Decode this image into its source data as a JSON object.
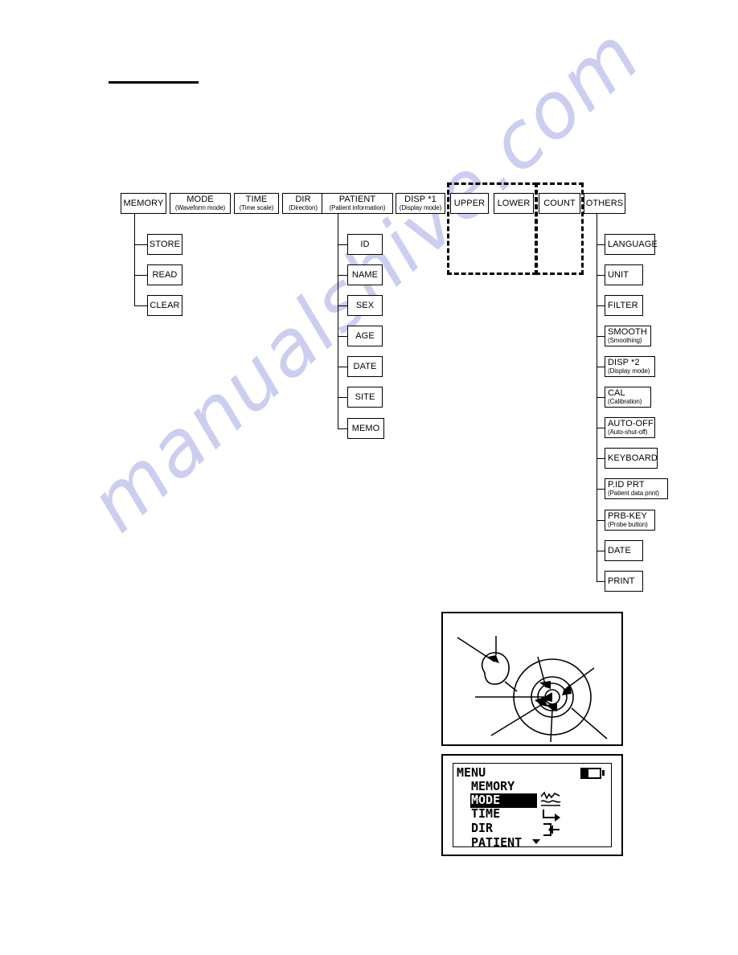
{
  "document": {
    "watermark": "manualshive.com"
  },
  "tree": {
    "top_row": [
      {
        "main": "MEMORY",
        "sub": ""
      },
      {
        "main": "MODE",
        "sub": "(Waveform mode)"
      },
      {
        "main": "TIME",
        "sub": "(Time scale)"
      },
      {
        "main": "DIR",
        "sub": "(Direction)"
      },
      {
        "main": "PATIENT",
        "sub": "(Patient information)"
      },
      {
        "main": "DISP *1",
        "sub": "(Display mode)"
      },
      {
        "main": "UPPER",
        "sub": ""
      },
      {
        "main": "LOWER",
        "sub": ""
      },
      {
        "main": "COUNT",
        "sub": ""
      },
      {
        "main": "OTHERS",
        "sub": ""
      }
    ],
    "memory_children": [
      {
        "main": "STORE",
        "sub": ""
      },
      {
        "main": "READ",
        "sub": ""
      },
      {
        "main": "CLEAR",
        "sub": ""
      }
    ],
    "patient_children": [
      {
        "main": "ID",
        "sub": ""
      },
      {
        "main": "NAME",
        "sub": ""
      },
      {
        "main": "SEX",
        "sub": ""
      },
      {
        "main": "AGE",
        "sub": ""
      },
      {
        "main": "DATE",
        "sub": ""
      },
      {
        "main": "SITE",
        "sub": ""
      },
      {
        "main": "MEMO",
        "sub": ""
      }
    ],
    "others_children": [
      {
        "main": "LANGUAGE",
        "sub": ""
      },
      {
        "main": "UNIT",
        "sub": ""
      },
      {
        "main": "FILTER",
        "sub": ""
      },
      {
        "main": "SMOOTH",
        "sub": "(Smoothing)"
      },
      {
        "main": "DISP *2",
        "sub": "(Display mode)"
      },
      {
        "main": "CAL",
        "sub": "(Calibration)"
      },
      {
        "main": "AUTO-OFF",
        "sub": "(Auto-shut-off)"
      },
      {
        "main": "KEYBOARD",
        "sub": ""
      },
      {
        "main": "P.ID PRT",
        "sub": "(Patient data print)"
      },
      {
        "main": "PRB-KEY",
        "sub": "(Probe button)"
      },
      {
        "main": "DATE",
        "sub": ""
      },
      {
        "main": "PRINT",
        "sub": ""
      }
    ]
  },
  "lcd": {
    "header": "MENU",
    "items": [
      {
        "label": "MEMORY",
        "icon": "",
        "selected": false
      },
      {
        "label": "MODE",
        "icon": "waveform",
        "selected": true
      },
      {
        "label": "TIME",
        "icon": "time-arrow",
        "selected": false
      },
      {
        "label": "DIR",
        "icon": "direction",
        "selected": false
      },
      {
        "label": "PATIENT",
        "icon": "",
        "selected": false
      }
    ],
    "battery": "battery-icon",
    "scroll_indicator": "scroll-down-caret"
  },
  "illustration": {
    "name": "probe-dial-callout-illustration"
  }
}
